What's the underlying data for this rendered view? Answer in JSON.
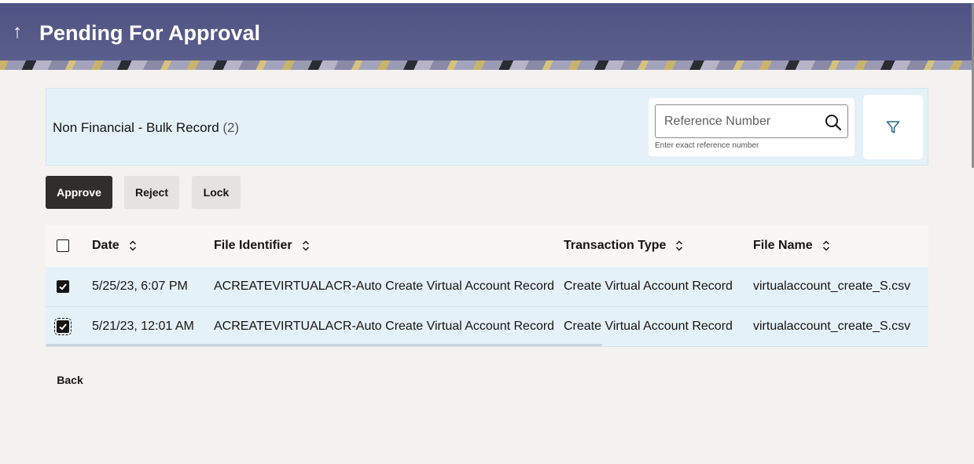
{
  "header": {
    "title": "Pending For Approval",
    "back_arrow_icon": "arrow-up-icon"
  },
  "panel": {
    "heading": "Non Financial - Bulk Record",
    "count": "(2)",
    "search": {
      "placeholder": "Reference Number",
      "value": "",
      "hint": "Enter exact reference number",
      "icon": "search-icon"
    },
    "filter_icon": "filter-icon"
  },
  "actions": {
    "approve": "Approve",
    "reject": "Reject",
    "lock": "Lock"
  },
  "table": {
    "columns": [
      "Date",
      "File Identifier",
      "Transaction Type",
      "File Name"
    ],
    "select_all_checked": false,
    "rows": [
      {
        "checked": true,
        "date": "5/25/23, 6:07 PM",
        "file_identifier": "ACREATEVIRTUALACR-Auto Create Virtual Account Record",
        "transaction_type": "Create Virtual Account Record",
        "file_name": "virtualaccount_create_S.csv"
      },
      {
        "checked": true,
        "date": "5/21/23, 12:01 AM",
        "file_identifier": "ACREATEVIRTUALACR-Auto Create Virtual Account Record",
        "transaction_type": "Create Virtual Account Record",
        "file_name": "virtualaccount_create_S.csv"
      }
    ]
  },
  "footer": {
    "back": "Back"
  },
  "colors": {
    "header_bg": "#5a5d8a",
    "panel_bg": "#e4f1f8",
    "primary_button": "#312d2a",
    "secondary_button": "#e4e3e1",
    "filter_icon": "#2a6f87"
  }
}
